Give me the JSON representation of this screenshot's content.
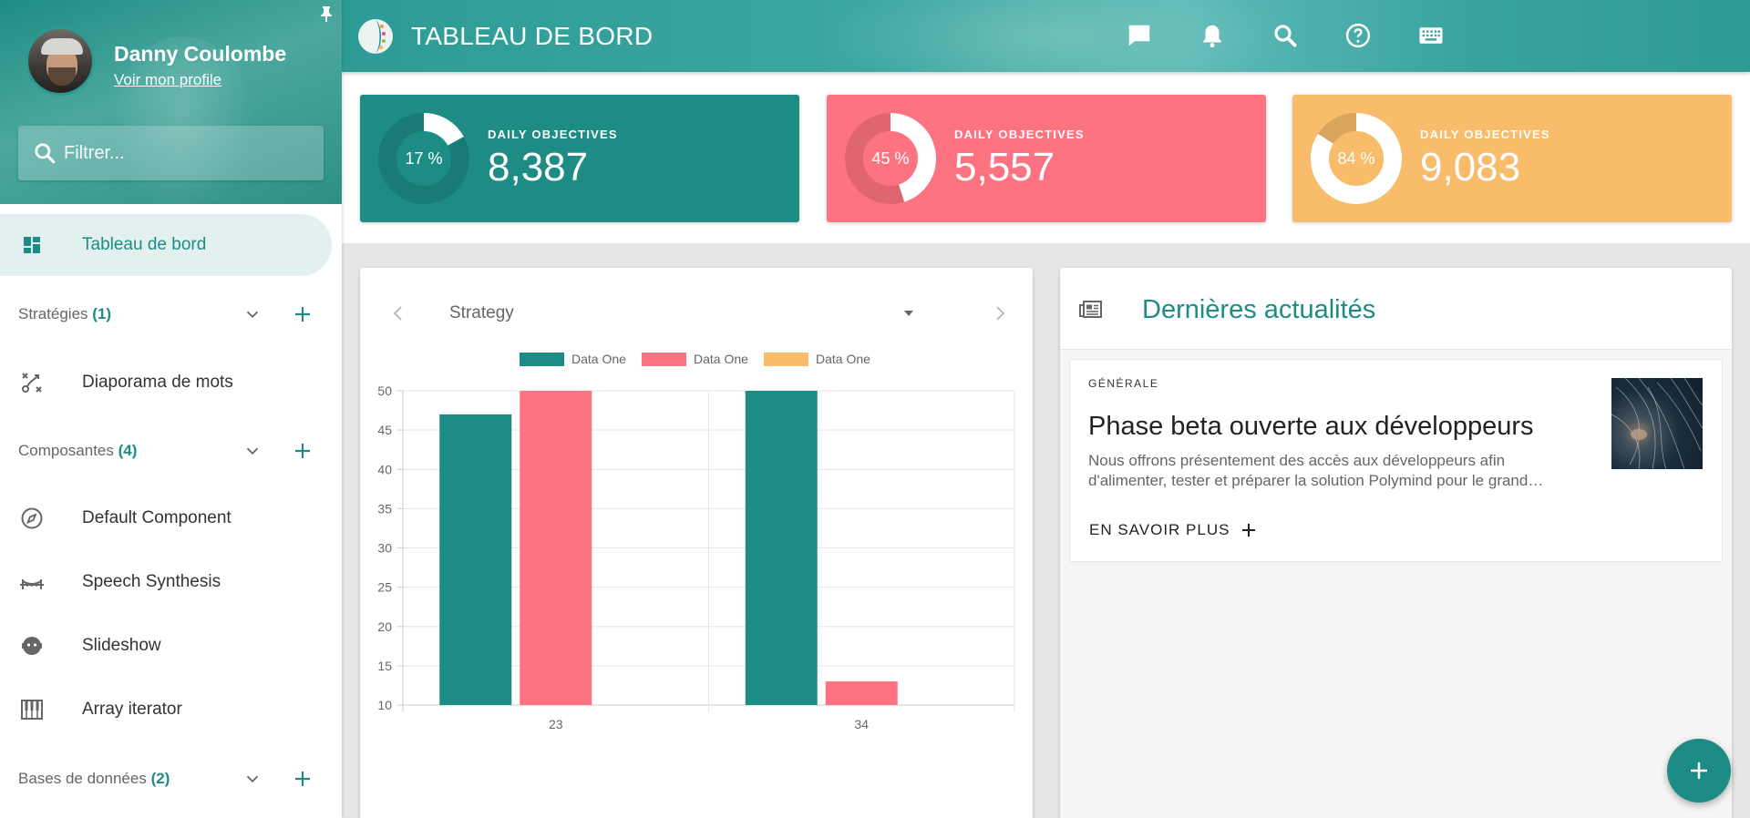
{
  "user": {
    "name": "Danny Coulombe",
    "profile_link": "Voir mon profile"
  },
  "filter": {
    "placeholder": "Filtrer..."
  },
  "nav": {
    "dashboard": "Tableau de bord",
    "sections": [
      {
        "label": "Stratégies",
        "count": "(1)"
      },
      {
        "label": "Composantes",
        "count": "(4)"
      },
      {
        "label": "Bases de données",
        "count": "(2)"
      }
    ],
    "items": [
      {
        "label": "Diaporama de mots",
        "icon": "strategy-icon"
      },
      {
        "label": "Default Component",
        "icon": "compass-icon"
      },
      {
        "label": "Speech Synthesis",
        "icon": "bridge-icon"
      },
      {
        "label": "Slideshow",
        "icon": "face-icon"
      },
      {
        "label": "Array iterator",
        "icon": "piano-icon"
      }
    ]
  },
  "topbar": {
    "title": "TABLEAU DE BORD",
    "icons": [
      "chat-icon",
      "bell-icon",
      "search-icon",
      "help-icon",
      "keyboard-icon"
    ]
  },
  "stats": [
    {
      "label": "DAILY OBJECTIVES",
      "value": "8,387",
      "percent_label": "17 %",
      "percent": 17,
      "color": "#1d8c84"
    },
    {
      "label": "DAILY OBJECTIVES",
      "value": "5,557",
      "percent_label": "45 %",
      "percent": 45,
      "color": "#fe7381"
    },
    {
      "label": "DAILY OBJECTIVES",
      "value": "9,083",
      "percent_label": "84 %",
      "percent": 84,
      "color": "#f8bc6b"
    }
  ],
  "chart_panel": {
    "selected": "Strategy"
  },
  "chart_data": {
    "type": "bar",
    "categories": [
      "23",
      "34"
    ],
    "series": [
      {
        "name": "Data One",
        "values": [
          47,
          50
        ],
        "color": "#1d8c84"
      },
      {
        "name": "Data One",
        "values": [
          50,
          13
        ],
        "color": "#fe7381"
      },
      {
        "name": "Data One",
        "values": [
          null,
          null
        ],
        "color": "#f8bc6b"
      }
    ],
    "ylim": [
      10,
      50
    ],
    "yticks": [
      10,
      15,
      20,
      25,
      30,
      35,
      40,
      45,
      50
    ],
    "grid": true,
    "legend": "top"
  },
  "news": {
    "header": "Dernières actualités",
    "items": [
      {
        "category": "GÉNÉRALE",
        "title": "Phase beta ouverte aux développeurs",
        "description": "Nous offrons présentement des accès aux développeurs afin d'alimenter, tester et préparer la solution Polymind pour le grand…",
        "more": "EN SAVOIR PLUS"
      }
    ]
  },
  "colors": {
    "accent": "#1d8c84",
    "pink": "#fe7381",
    "orange": "#f8bc6b"
  }
}
